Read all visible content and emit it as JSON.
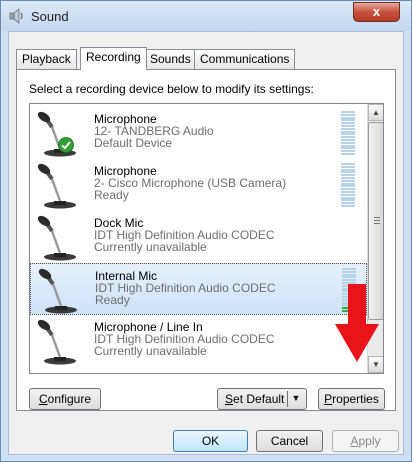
{
  "window": {
    "title": "Sound",
    "close_label": "x",
    "title_icon": "speaker-icon"
  },
  "tabs": [
    {
      "label": "Playback",
      "active": false
    },
    {
      "label": "Recording",
      "active": true
    },
    {
      "label": "Sounds",
      "active": false
    },
    {
      "label": "Communications",
      "active": false
    }
  ],
  "panel": {
    "instruction": "Select a recording device below to modify its settings:"
  },
  "devices": [
    {
      "name": "Microphone",
      "description": "12- TANDBERG Audio",
      "status": "Default Device",
      "selected": false,
      "default_badge": true,
      "meter_level": 0
    },
    {
      "name": "Microphone",
      "description": "2- Cisco Microphone (USB Camera)",
      "status": "Ready",
      "selected": false,
      "default_badge": false,
      "meter_level": 0
    },
    {
      "name": "Dock Mic",
      "description": "IDT High Definition Audio CODEC",
      "status": "Currently unavailable",
      "selected": false,
      "default_badge": false,
      "meter_level": null
    },
    {
      "name": "Internal Mic",
      "description": "IDT High Definition Audio CODEC",
      "status": "Ready",
      "selected": true,
      "default_badge": false,
      "meter_level": 0.1
    },
    {
      "name": "Microphone / Line In",
      "description": "IDT High Definition Audio CODEC",
      "status": "Currently unavailable",
      "selected": false,
      "default_badge": false,
      "meter_level": null
    }
  ],
  "buttons": {
    "configure_key": "C",
    "configure_rest": "onfigure",
    "set_default_key": "S",
    "set_default_rest": "et Default",
    "properties_key": "P",
    "properties_rest": "roperties",
    "ok": "OK",
    "cancel": "Cancel",
    "apply_key": "A",
    "apply_rest": "pply"
  },
  "colors": {
    "annotation_arrow": "#e8141a",
    "selection": "#cde2f8",
    "meter_active": "#3aa54a",
    "meter_idle": "#b7d3e8"
  },
  "icons": {
    "device": "microphone-icon",
    "default_badge": "green-check-icon",
    "scroll_up": "chevron-up-icon",
    "scroll_down": "chevron-down-icon",
    "split_dropdown": "dropdown-arrow-icon"
  }
}
